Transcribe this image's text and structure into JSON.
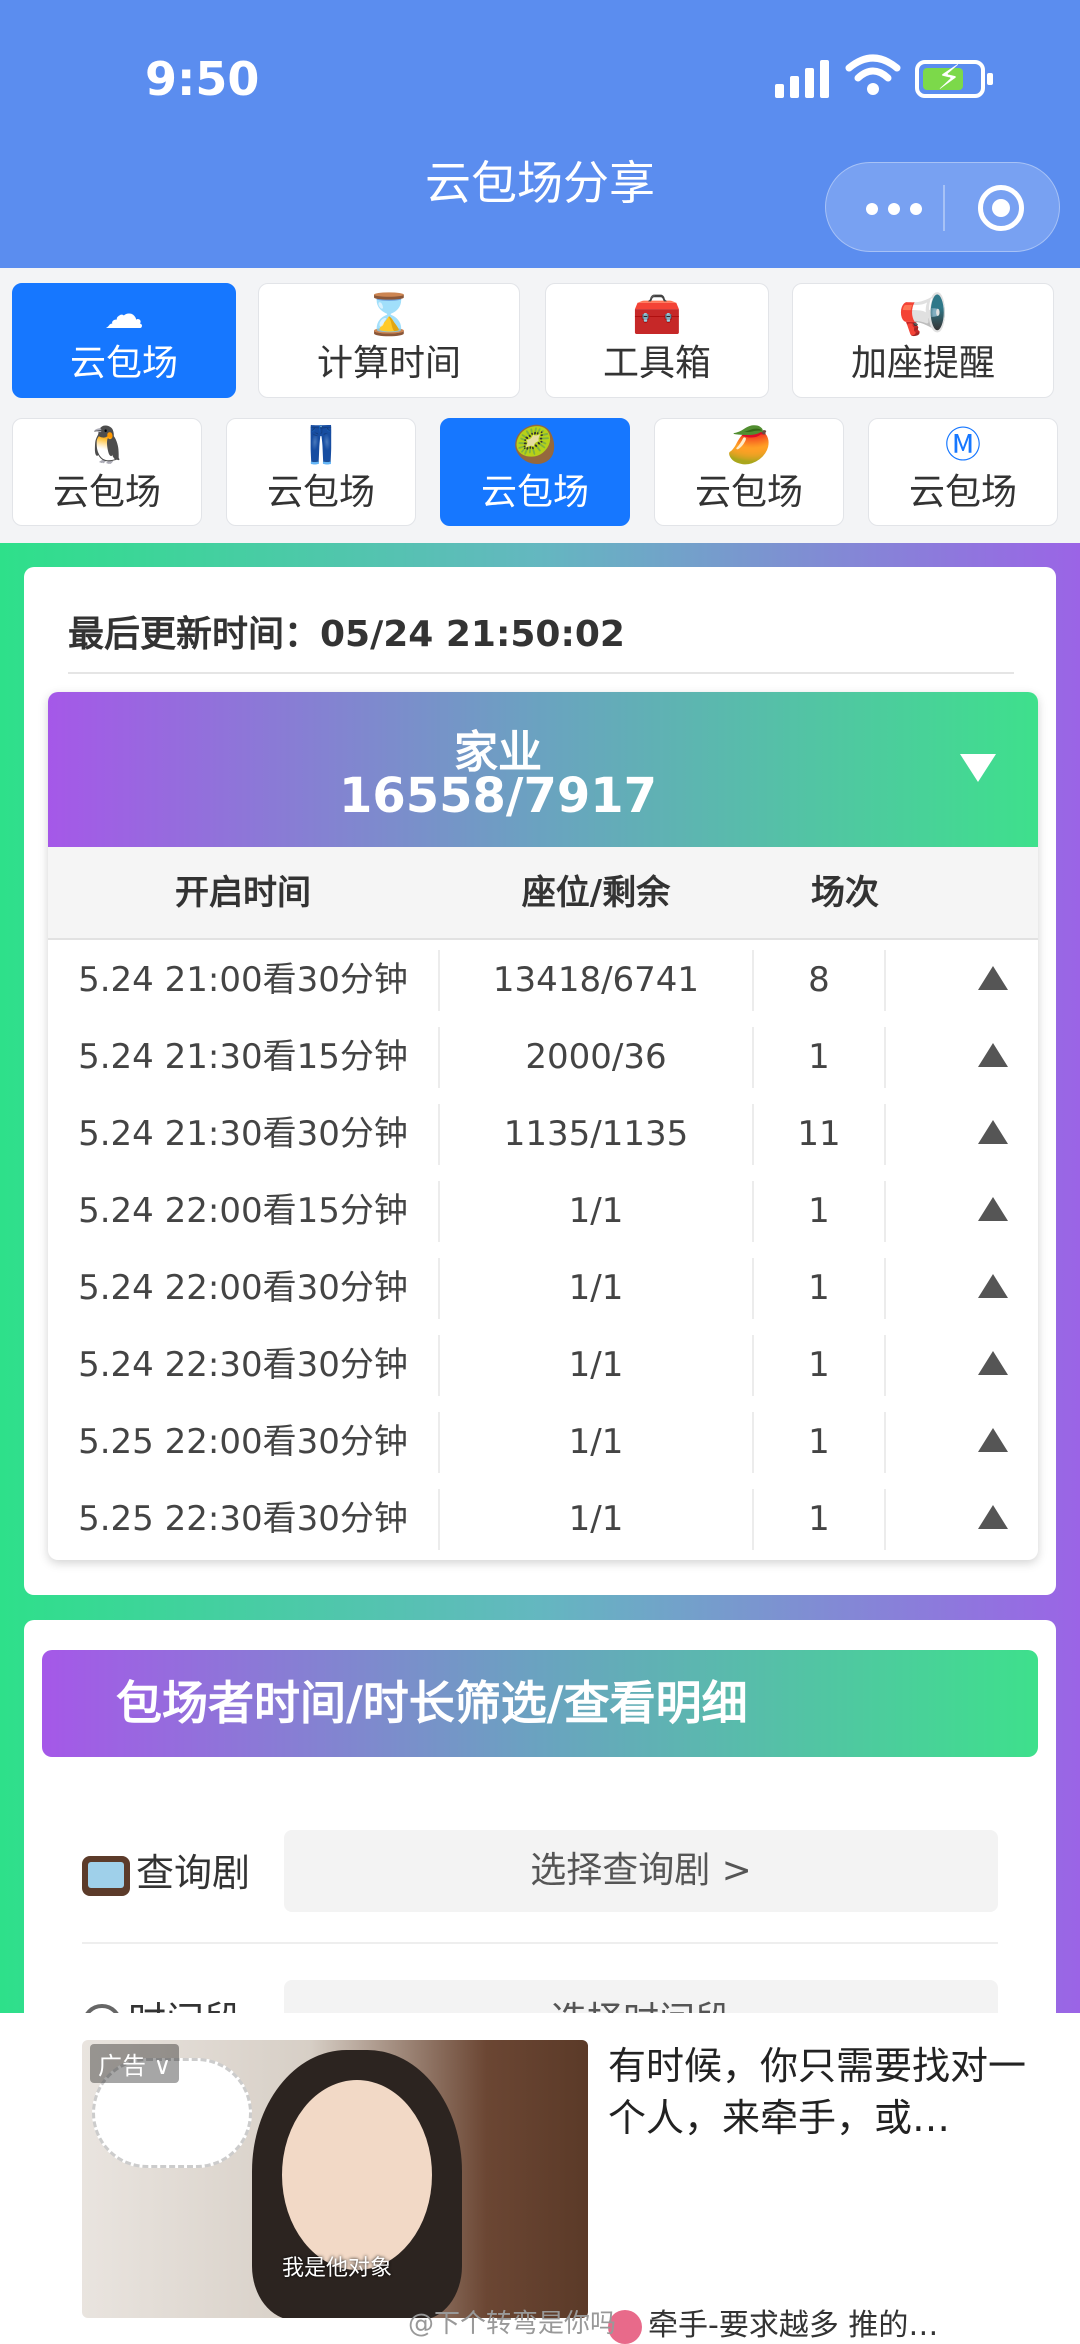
{
  "status_bar": {
    "time": "9:50"
  },
  "nav": {
    "title": "云包场分享"
  },
  "tabs_primary": [
    {
      "label": "云包场",
      "icon": "cloud-icon",
      "active": true
    },
    {
      "label": "计算时间",
      "icon": "hourglass-icon",
      "active": false
    },
    {
      "label": "工具箱",
      "icon": "toolbox-icon",
      "active": false
    },
    {
      "label": "加座提醒",
      "icon": "megaphone-icon",
      "active": false
    }
  ],
  "tabs_secondary": [
    {
      "label": "云包场",
      "icon": "penguin-icon",
      "active": false
    },
    {
      "label": "云包场",
      "icon": "jeans-icon",
      "active": false
    },
    {
      "label": "云包场",
      "icon": "kiwi-icon",
      "active": true
    },
    {
      "label": "云包场",
      "icon": "mango-icon",
      "active": false
    },
    {
      "label": "云包场",
      "icon": "m-circle-icon",
      "active": false
    }
  ],
  "update": {
    "text": "最后更新时间：05/24 21:50:02"
  },
  "series": {
    "name": "家业",
    "numbers": "16558/7917"
  },
  "table": {
    "headers": [
      "开启时间",
      "座位/剩余",
      "场次"
    ],
    "rows": [
      {
        "time": "5.24 21:00看30分钟",
        "seats": "13418/6741",
        "count": "8"
      },
      {
        "time": "5.24 21:30看15分钟",
        "seats": "2000/36",
        "count": "1"
      },
      {
        "time": "5.24 21:30看30分钟",
        "seats": "1135/1135",
        "count": "11"
      },
      {
        "time": "5.24 22:00看15分钟",
        "seats": "1/1",
        "count": "1"
      },
      {
        "time": "5.24 22:00看30分钟",
        "seats": "1/1",
        "count": "1"
      },
      {
        "time": "5.24 22:30看30分钟",
        "seats": "1/1",
        "count": "1"
      },
      {
        "time": "5.25 22:00看30分钟",
        "seats": "1/1",
        "count": "1"
      },
      {
        "time": "5.25 22:30看30分钟",
        "seats": "1/1",
        "count": "1"
      }
    ]
  },
  "filter": {
    "title": "包场者时间/时长筛选/查看明细",
    "drama_label": "查询剧",
    "drama_button": "选择查询剧 >",
    "time_label": "时间段",
    "time_button": "选择时间段"
  },
  "ad": {
    "tag": "广告 ∨",
    "subtitle": "我是他对象",
    "text": "有时候，你只需要找对一个人，来牵手，或…",
    "bottom": "牵手-要求越多 推的…",
    "watermark": "@下个转弯是你吗"
  },
  "colors": {
    "nav_bg": "#5b8def",
    "active_tab": "#1677ff",
    "grad_purple": "#a558e8",
    "grad_green": "#3ee08c"
  }
}
